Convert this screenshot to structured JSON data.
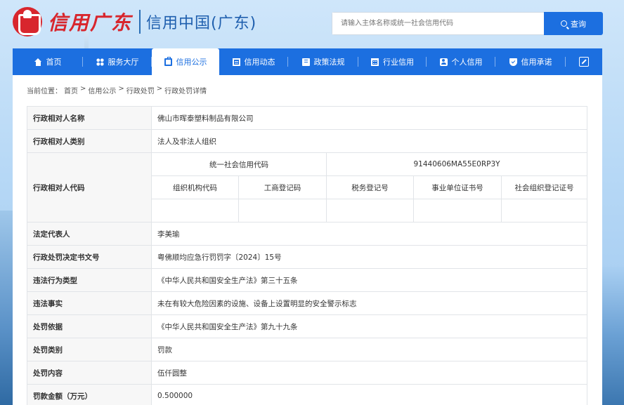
{
  "header": {
    "logo_script": "信用广东",
    "site_title": "信用中国(广东)",
    "search_placeholder": "请输入主体名称或统一社会信用代码",
    "search_button": "查询"
  },
  "nav": {
    "items": [
      {
        "label": "首页",
        "icon": "home-icon"
      },
      {
        "label": "服务大厅",
        "icon": "grid-icon"
      },
      {
        "label": "信用公示",
        "icon": "briefcase-icon",
        "active": true
      },
      {
        "label": "信用动态",
        "icon": "document-icon"
      },
      {
        "label": "政策法规",
        "icon": "book-icon"
      },
      {
        "label": "行业信用",
        "icon": "building-icon"
      },
      {
        "label": "个人信用",
        "icon": "person-card-icon"
      },
      {
        "label": "信用承诺",
        "icon": "shield-icon"
      }
    ],
    "expand_icon": "expand-icon"
  },
  "breadcrumb": {
    "prefix": "当前位置：",
    "items": [
      "首页",
      "信用公示",
      "行政处罚",
      "行政处罚详情"
    ],
    "separator": ">"
  },
  "detail": {
    "subject_name": {
      "label": "行政相对人名称",
      "value": "佛山市晖泰塑料制品有限公司"
    },
    "subject_type": {
      "label": "行政相对人类别",
      "value": "法人及非法人组织"
    },
    "subject_code": {
      "label": "行政相对人代码",
      "uscc_label": "统一社会信用代码",
      "uscc_value": "91440606MA55E0RP3Y",
      "sub_headers": [
        "组织机构代码",
        "工商登记码",
        "税务登记号",
        "事业单位证书号",
        "社会组织登记证号"
      ],
      "sub_values": [
        "",
        "",
        "",
        "",
        ""
      ]
    },
    "legal_rep": {
      "label": "法定代表人",
      "value": "李美瑜"
    },
    "decision_no": {
      "label": "行政处罚决定书文号",
      "value": "粤佛顺均应急行罚罚字〔2024〕15号"
    },
    "violation_type": {
      "label": "违法行为类型",
      "value": "《中华人民共和国安全生产法》第三十五条"
    },
    "violation_facts": {
      "label": "违法事实",
      "value": "未在有较大危险因素的设施、设备上设置明显的安全警示标志"
    },
    "basis": {
      "label": "处罚依据",
      "value": "《中华人民共和国安全生产法》第九十九条"
    },
    "penalty_category": {
      "label": "处罚类别",
      "value": "罚款"
    },
    "penalty_content": {
      "label": "处罚内容",
      "value": "伍仟圆整"
    },
    "fine_amount": {
      "label": "罚款金额（万元）",
      "value": "0.500000"
    }
  },
  "colors": {
    "primary": "#1c6fe0",
    "logo_red": "#d8262d",
    "label_bg": "#f7f7f7",
    "border": "#e1e4e8"
  }
}
